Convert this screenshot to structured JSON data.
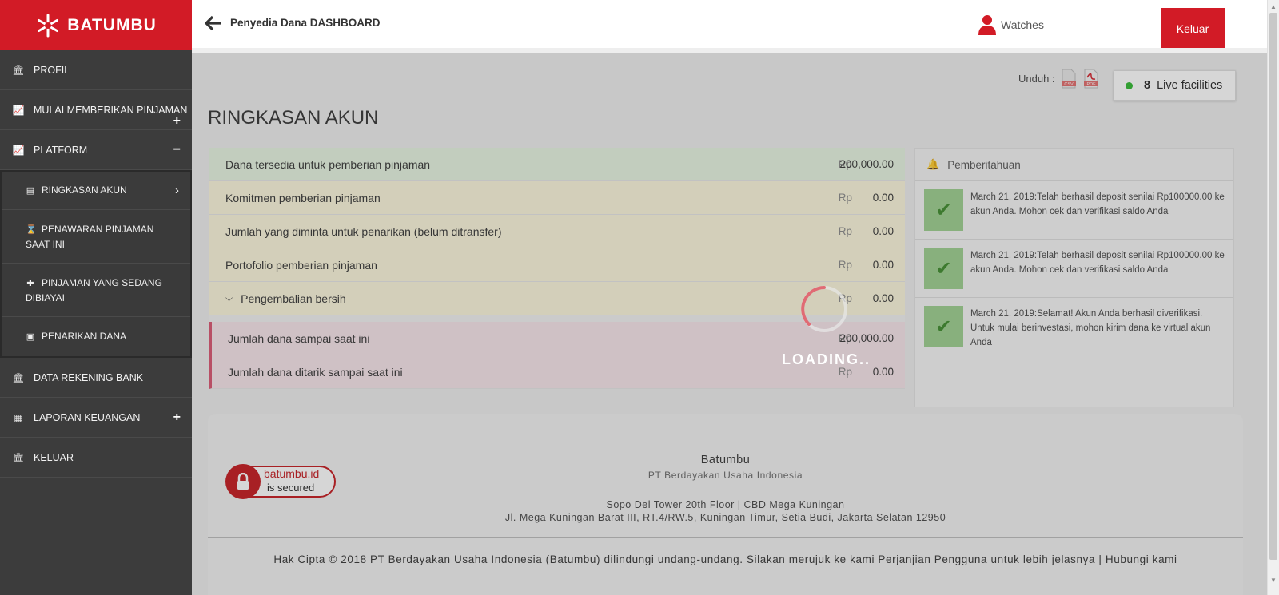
{
  "brand": {
    "name": "BATUMBU",
    "color": "#d21b26"
  },
  "header": {
    "page_title": "Penyedia Dana DASHBOARD",
    "user_name": "Watches",
    "logout_label": "Keluar"
  },
  "sidebar": {
    "items": [
      {
        "label": "PROFIL",
        "icon": "bank-icon"
      },
      {
        "label": "MULAI MEMBERIKAN PINJAMAN",
        "icon": "chart-line-icon",
        "toggle": "+"
      },
      {
        "label": "PLATFORM",
        "icon": "chart-line-icon",
        "toggle": "−"
      },
      {
        "label": "DATA REKENING BANK",
        "icon": "bank-icon"
      },
      {
        "label": "LAPORAN KEUANGAN",
        "icon": "calculator-icon",
        "toggle": "+"
      },
      {
        "label": "KELUAR",
        "icon": "bank-icon"
      }
    ],
    "platform_sub": [
      {
        "label": "RINGKASAN AKUN",
        "icon": "document-icon"
      },
      {
        "label": "PENAWARAN PINJAMAN SAAT INI",
        "icon": "hourglass-icon"
      },
      {
        "label": "PINJAMAN YANG SEDANG DIBIAYAI",
        "icon": "puzzle-icon"
      },
      {
        "label": "PENARIKAN DANA",
        "icon": "money-icon"
      }
    ]
  },
  "main": {
    "download_label": "Unduh :",
    "download_files": [
      "CSV",
      "PDF"
    ],
    "live": {
      "count": "8",
      "label": "Live facilities"
    },
    "section_title": "RINGKASAN AKUN",
    "currency": "Rp",
    "rows": [
      {
        "label": "Dana tersedia untuk pemberian pinjaman",
        "value": "200,000.00"
      },
      {
        "label": "Komitmen pemberian pinjaman",
        "value": "0.00"
      },
      {
        "label": "Jumlah yang diminta untuk penarikan (belum ditransfer)",
        "value": "0.00"
      },
      {
        "label": "Portofolio pemberian pinjaman",
        "value": "0.00"
      },
      {
        "label": "Pengembalian bersih",
        "value": "0.00"
      }
    ],
    "rows2": [
      {
        "label": "Jumlah dana sampai saat ini",
        "value": "200,000.00"
      },
      {
        "label": "Jumlah dana ditarik sampai saat ini",
        "value": "0.00"
      }
    ]
  },
  "notifications": {
    "title": "Pemberitahuan",
    "items": [
      {
        "text": "March 21, 2019:Telah berhasil deposit senilai Rp100000.00 ke akun Anda. Mohon cek dan verifikasi saldo Anda"
      },
      {
        "text": "March 21, 2019:Telah berhasil deposit senilai Rp100000.00 ke akun Anda. Mohon cek dan verifikasi saldo Anda"
      },
      {
        "text": "March 21, 2019:Selamat! Akun Anda berhasil diverifikasi. Untuk mulai berinvestasi, mohon kirim dana ke virtual akun Anda"
      }
    ]
  },
  "footer": {
    "badge_line1": "batumbu.id",
    "badge_line2": "is secured",
    "brand": "Batumbu",
    "company": "PT Berdayakan Usaha Indonesia",
    "address1": "Sopo Del Tower 20th Floor | CBD Mega Kuningan",
    "address2": "Jl. Mega Kuningan Barat III, RT.4/RW.5, Kuningan Timur, Setia Budi, Jakarta Selatan 12950",
    "copyright": "Hak Cipta © 2018 PT Berdayakan Usaha Indonesia (Batumbu) dilindungi undang-undang. Silakan merujuk ke kami Perjanjian Pengguna untuk lebih jelasnya | Hubungi kami"
  },
  "loading": {
    "label": "LOADING.."
  }
}
